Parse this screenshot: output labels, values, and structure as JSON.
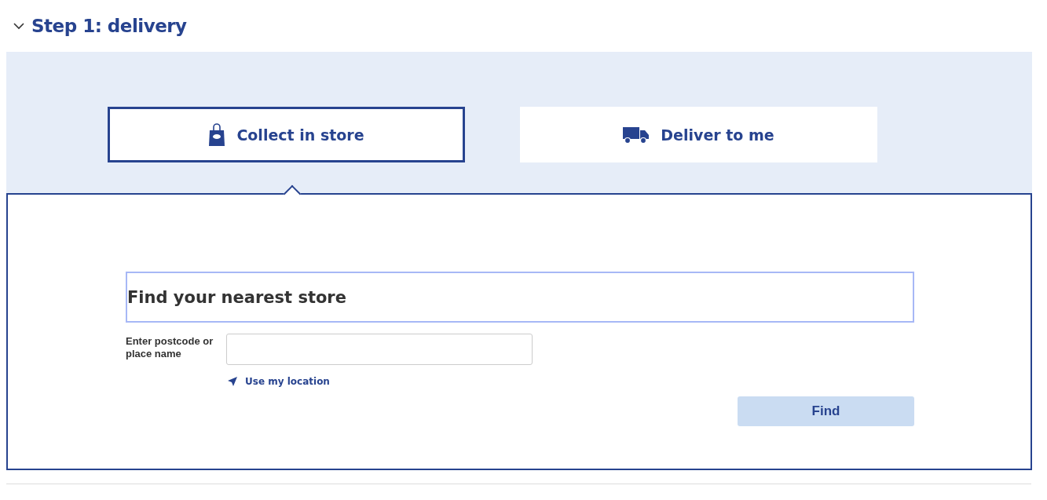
{
  "section": {
    "title": "Step 1: delivery",
    "expanded": true
  },
  "tabs": [
    {
      "label": "Collect in store",
      "selected": true
    },
    {
      "label": "Deliver to me",
      "selected": false
    }
  ],
  "store_finder": {
    "title": "Find your nearest store",
    "field_label": "Enter postcode or place name",
    "location_link": "Use my location",
    "button": "Find"
  }
}
